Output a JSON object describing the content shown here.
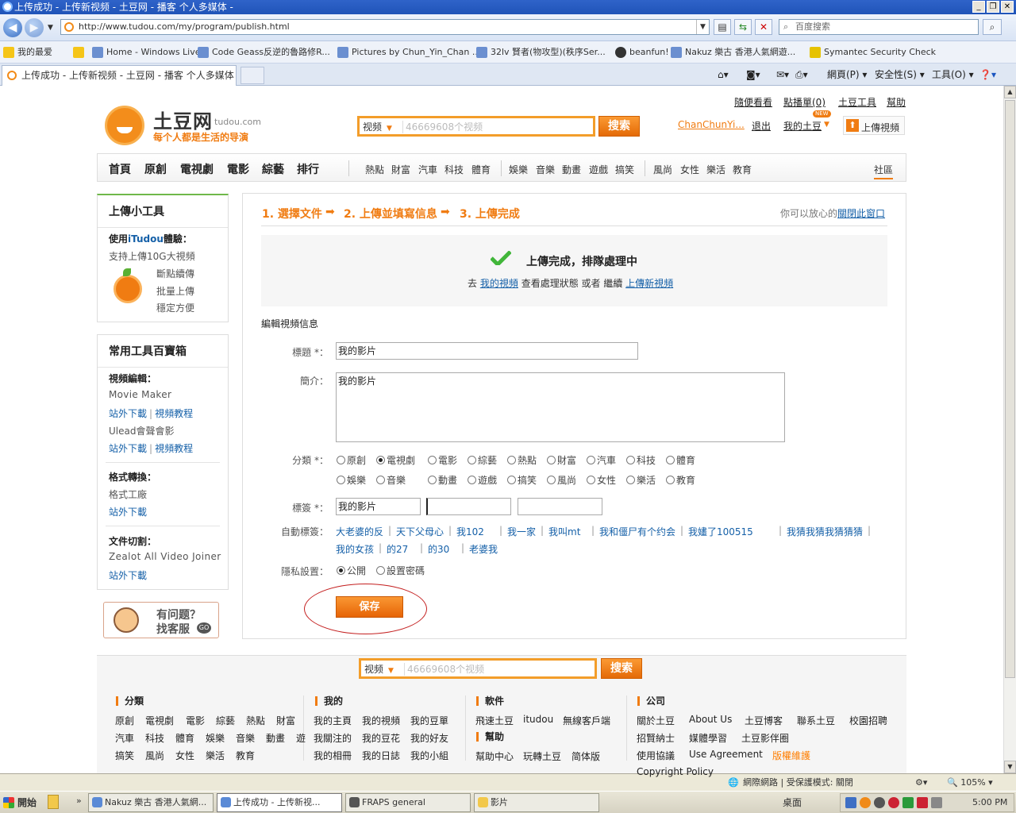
{
  "browser": {
    "window_title": "上传成功 - 上传新视频 - 土豆网 - 播客 个人多媒体 -",
    "address": "http://www.tudou.com/my/program/publish.html",
    "search_placeholder": "百度搜索",
    "favorites_label": "我的最爱",
    "favorites": [
      "Home - Windows Live",
      "Code Geass反逆的魯路修R...",
      "Pictures by Chun_Yin_Chan ...",
      "32lv 賢者(物攻型)(秩序Ser...",
      "beanfun!",
      "Nakuz 樂古 香港人氣網遊...",
      "Symantec Security Check"
    ],
    "tab_title": "上传成功 - 上传新视频 - 土豆网 - 播客 个人多媒体",
    "toolbar": {
      "page": "網頁(P)",
      "safety": "安全性(S)",
      "tools": "工具(O)"
    },
    "status": {
      "zone": "網際網路 | 受保護模式: 關閉",
      "zoom": "105%"
    },
    "taskbar": {
      "start": "開始",
      "tasks": [
        "Nakuz 樂古 香港人氣網...",
        "上传成功 - 上传新视...",
        "FRAPS general",
        "影片"
      ],
      "desktop": "桌面",
      "clock": "5:00 PM"
    }
  },
  "site": {
    "brand": "土豆网",
    "brand_en": "tudou.com",
    "slogan": "每个人都是生活的导演",
    "search": {
      "category": "视频",
      "placeholder": "46669608个视频",
      "button": "搜索"
    },
    "top_links": [
      "隨便看看",
      "點播單(0)",
      "土豆工具",
      "幫助"
    ],
    "user": {
      "name": "ChanChunYi...",
      "logout": "退出",
      "my": "我的土豆",
      "upload": "上傳視頻",
      "new_badge": "NEW"
    },
    "main_nav": [
      "首頁",
      "原創",
      "電視劇",
      "電影",
      "綜藝",
      "排行"
    ],
    "sub_nav_a": [
      "熱點",
      "財富",
      "汽車",
      "科技",
      "體育"
    ],
    "sub_nav_b": [
      "娛樂",
      "音樂",
      "動畫",
      "遊戲",
      "搞笑"
    ],
    "sub_nav_c": [
      "風尚",
      "女性",
      "樂活",
      "教育"
    ],
    "community": "社區"
  },
  "sidebar": {
    "tools_title": "上傳小工具",
    "use_prefix": "使用",
    "use_brand": "iTudou",
    "use_suffix": "體驗：",
    "support": "支持上傳10G大視頻",
    "features": [
      "斷點續傳",
      "批量上傳",
      "穩定方便"
    ],
    "box_title": "常用工具百寶箱",
    "edit_heading": "視頻編輯：",
    "movie_maker": "Movie Maker",
    "offsite": "站外下載",
    "tutorial": "視頻教程",
    "ulead": "Ulead會聲會影",
    "convert_heading": "格式轉換：",
    "format_factory": "格式工廠",
    "cut_heading": "文件切割：",
    "zealot": "Zealot All Video Joiner",
    "help_q": "有问题？",
    "help_a": "找客服",
    "help_go": "GO"
  },
  "main": {
    "steps": [
      "1. 選擇文件",
      "2. 上傳並填寫信息",
      "3. 上傳完成"
    ],
    "close_prefix": "你可以放心的",
    "close_link": "關閉此窗口",
    "done_title": "上傳完成，排隊處理中",
    "done_go": "去",
    "done_my_videos": "我的視頻",
    "done_mid": "查看處理狀態 或者 繼續",
    "done_upload_new": "上傳新視頻",
    "edit_heading": "編輯視頻信息",
    "title_label": "標題 *：",
    "title_value": "我的影片",
    "desc_label": "簡介：",
    "desc_value": "我的影片",
    "category_label": "分類 *：",
    "categories_row1": [
      "原創",
      "電視劇",
      "電影",
      "綜藝",
      "熱點",
      "財富",
      "汽車",
      "科技",
      "體育"
    ],
    "categories_row2": [
      "娛樂",
      "音樂",
      "動畫",
      "遊戲",
      "搞笑",
      "風尚",
      "女性",
      "樂活",
      "教育"
    ],
    "selected_category": "電視劇",
    "tags_label": "標簽 *：",
    "tags": [
      "我的影片",
      "",
      ""
    ],
    "auto_tags_label": "自動標簽：",
    "auto_tags": [
      "大老婆的反",
      "天下父母心",
      "我102",
      "我一家",
      "我叫mt",
      "我和僵尸有个约会",
      "我嫿了100515",
      "我猜我猜我猜猜猜",
      "我的女孩",
      "的27",
      "的30",
      "老婆我"
    ],
    "privacy_label": "隱私設置：",
    "privacy_options": [
      "公開",
      "設置密碼"
    ],
    "privacy_selected": "公開",
    "save": "保存"
  },
  "footer": {
    "search": {
      "category": "视频",
      "placeholder": "46669608个视频",
      "button": "搜索"
    },
    "col1_title": "分類",
    "col1": [
      [
        "原創",
        "電視劇",
        "電影",
        "綜藝",
        "熱點",
        "財富"
      ],
      [
        "汽車",
        "科技",
        "體育",
        "娛樂",
        "音樂",
        "動畫",
        "遊戲"
      ],
      [
        "搞笑",
        "風尚",
        "女性",
        "樂活",
        "教育"
      ]
    ],
    "col2_title": "我的",
    "col2": [
      [
        "我的主頁",
        "我的視頻",
        "我的豆單"
      ],
      [
        "我關注的",
        "我的豆花",
        "我的好友"
      ],
      [
        "我的相冊",
        "我的日誌",
        "我的小組"
      ]
    ],
    "col3_title": "軟件",
    "col3": [
      "飛速土豆",
      "itudou",
      "無線客戶端"
    ],
    "col3b_title": "幫助",
    "col3b": [
      "幫助中心",
      "玩轉土豆",
      "简体版"
    ],
    "col4_title": "公司",
    "col4": [
      [
        "關於土豆",
        "About Us",
        "土豆博客",
        "聯系土豆",
        "校園招聘"
      ],
      [
        "招賢納士",
        "媒體學習",
        "土豆影伴圈"
      ],
      [
        "使用協議",
        "Use Agreement",
        "版權維護"
      ],
      [
        "Copyright Policy"
      ]
    ]
  },
  "colors": {
    "accent": "#f07c12",
    "link": "#1560a8",
    "highlight": "#ff7e00"
  }
}
